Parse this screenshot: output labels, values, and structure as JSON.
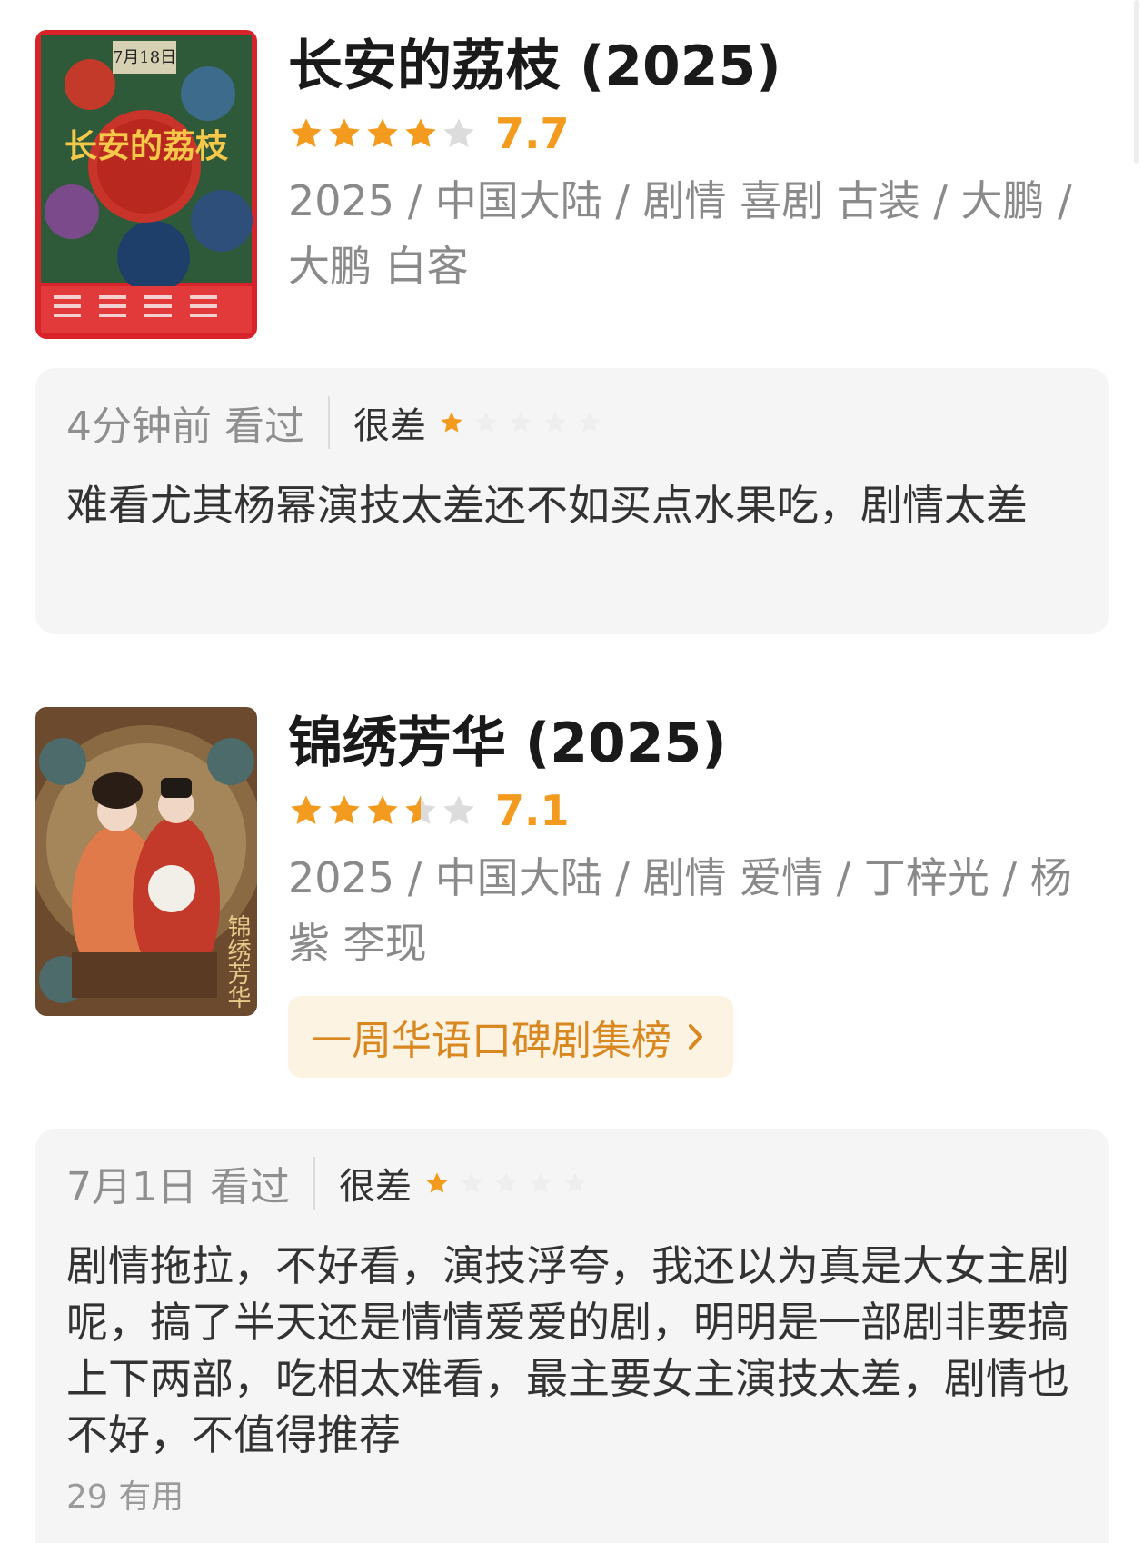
{
  "movies": [
    {
      "title": "长安的荔枝 (2025)",
      "rating": 7.7,
      "rating_label": "7.7",
      "stars": 4,
      "meta": "2025 / 中国大陆 / 剧情 喜剧 古装 / 大鹏 / 大鹏 白客",
      "poster": {
        "date_text": "7月18日",
        "title_text": "长安的荔枝"
      },
      "review": {
        "time": "4分钟前 看过",
        "verdict": "很差",
        "stars": 1,
        "text": "难看尤其杨幂演技太差还不如买点水果吃，剧情太差"
      }
    },
    {
      "title": "锦绣芳华 (2025)",
      "rating": 7.1,
      "rating_label": "7.1",
      "stars": 3.5,
      "meta": "2025 / 中国大陆 / 剧情 爱情 / 丁梓光 / 杨紫 李现",
      "poster": {
        "title_text": "锦绣芳华"
      },
      "ranking_label": "一周华语口碑剧集榜",
      "review": {
        "time": "7月1日 看过",
        "verdict": "很差",
        "stars": 1,
        "text": "剧情拖拉，不好看，演技浮夸，我还以为真是大女主剧呢，搞了半天还是情情爱爱的剧，明明是一部剧非要搞上下两部，吃相太难看，最主要女主演技太差，剧情也不好，不值得推荐",
        "useful": "29 有用"
      }
    }
  ],
  "colors": {
    "accent": "#f39b1f",
    "star_empty": "#dcdcdc",
    "pill_bg": "#fdf3e3",
    "card_bg": "#f5f5f5"
  }
}
